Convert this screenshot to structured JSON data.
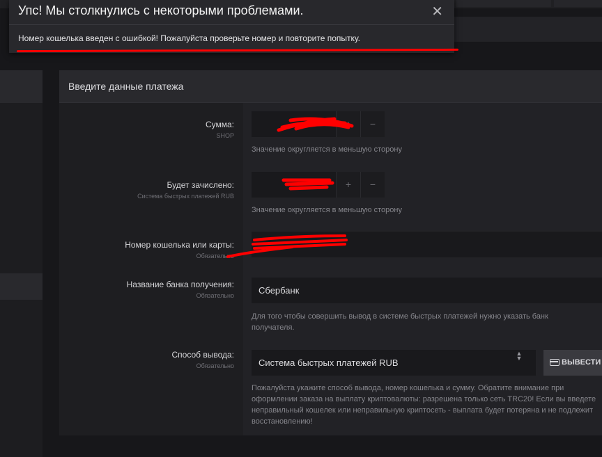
{
  "toast": {
    "title": "Упс! Мы столкнулись с некоторыми проблемами.",
    "close_glyph": "✕",
    "message": "Номер кошелька введен с ошибкой! Пожалуйста проверьте номер и повторите попытку."
  },
  "panel": {
    "title": "Введите данные платежа"
  },
  "form": {
    "amount": {
      "label": "Сумма:",
      "sub": "SHOP",
      "plus": "+",
      "minus": "−",
      "hint": "Значение округляется в меньшую сторону"
    },
    "credited": {
      "label": "Будет зачислено:",
      "sub": "Система быстрых платежей RUB",
      "plus": "+",
      "minus": "−",
      "hint": "Значение округляется в меньшую сторону"
    },
    "wallet": {
      "label": "Номер кошелька или карты:",
      "sub": "Обязательно"
    },
    "bank": {
      "label": "Название банка получения:",
      "sub": "Обязательно",
      "value": "Сбербанк",
      "hint": "Для того чтобы совершить вывод в системе быстрых платежей нужно указать банк получателя."
    },
    "method": {
      "label": "Способ вывода:",
      "sub": "Обязательно",
      "value": "Система быстрых платежей RUB",
      "caret": "▲▼",
      "button": "ВЫВЕСТИ",
      "hint": "Пожалуйста укажите способ вывода, номер кошелька и сумму. Обратите внимание при оформлении заказа на выплату криптовалюты: разрешена только сеть TRC20! Если вы введете неправильный кошелек или неправильную криптосеть - выплата будет потеряна и не подлежит восстановлению!"
    }
  },
  "colors": {
    "accent_red": "#ff0000",
    "background": "#17171a",
    "panel": "#1e1e21"
  }
}
